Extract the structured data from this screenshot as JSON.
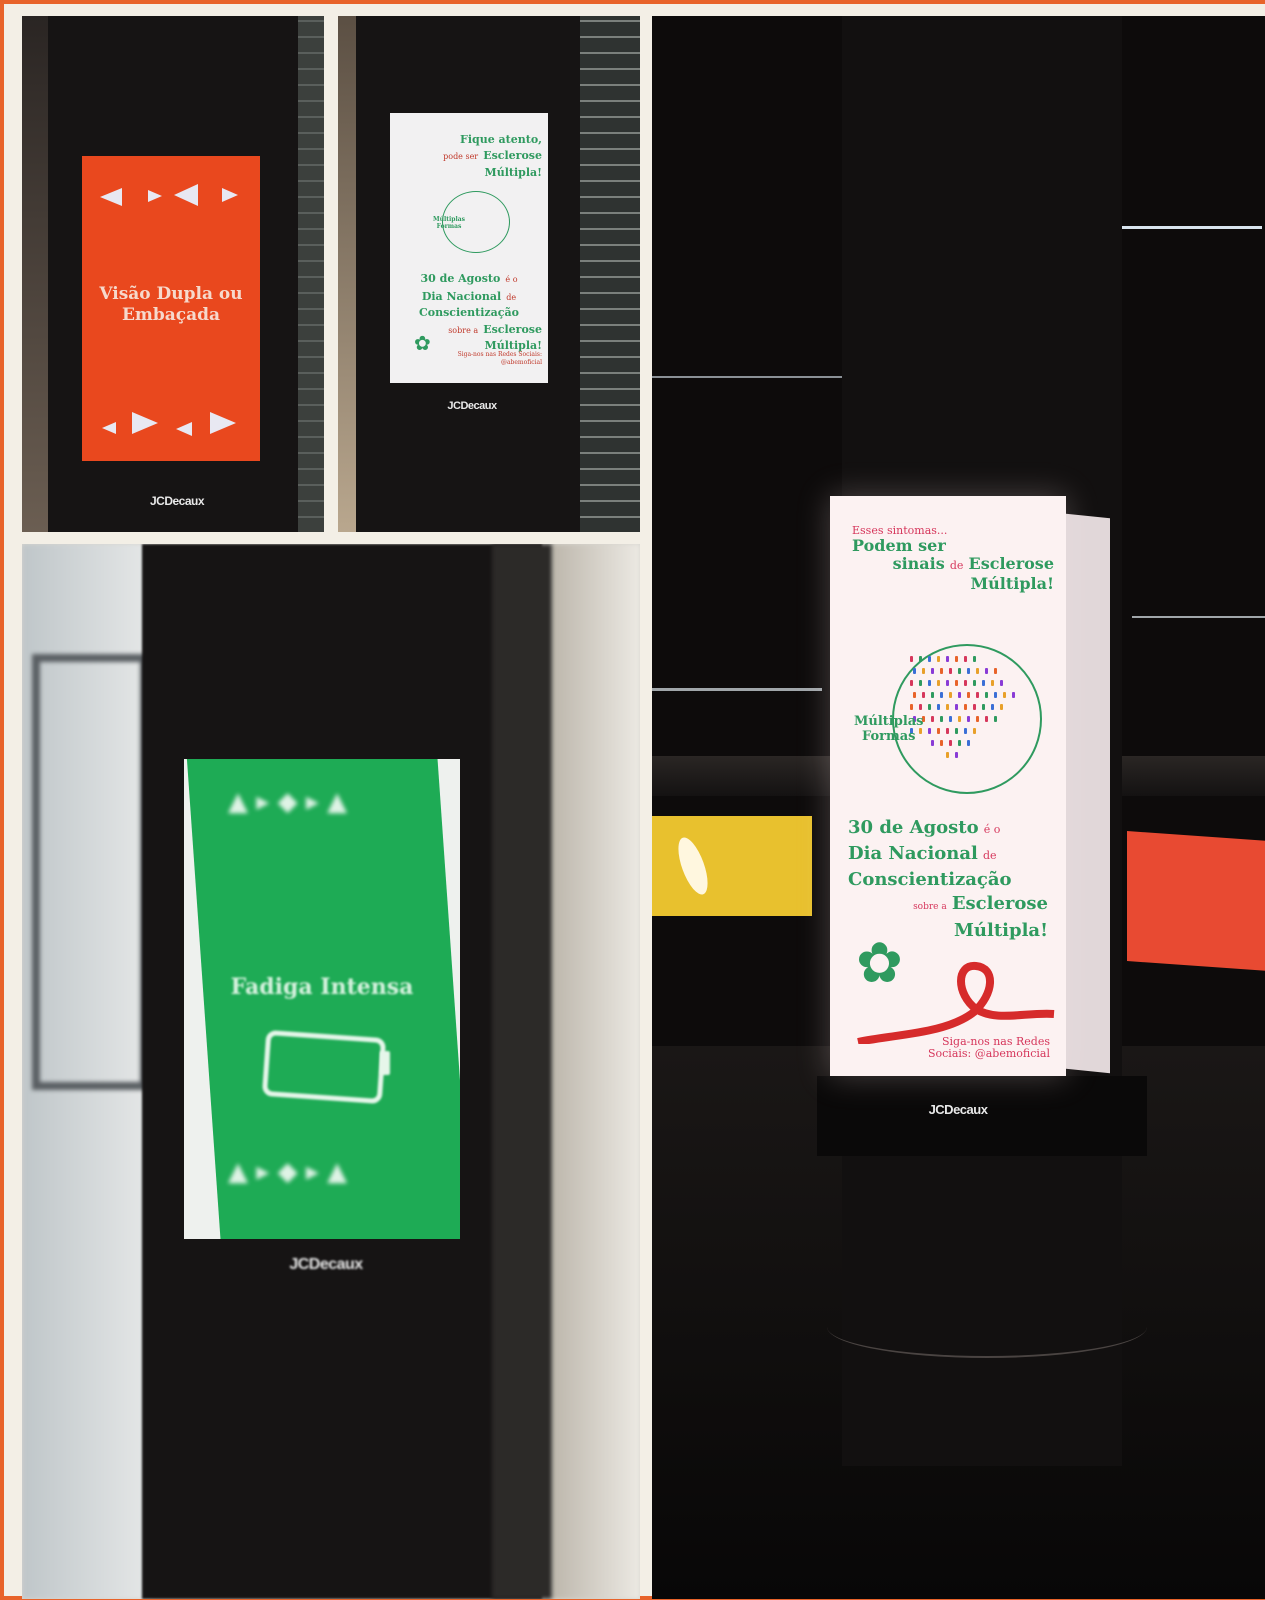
{
  "photos": {
    "top_left": {
      "screen_text": "Visão Dupla ou Embaçada",
      "brand": "JCDecaux",
      "colors": {
        "screen": "#e9481e",
        "text": "#f6d9cc"
      }
    },
    "top_right": {
      "headline_small": "Fique atento,",
      "headline_mid": "pode ser",
      "headline_big": "Esclerose Múltipla!",
      "logo_text": "Múltiplas Formas",
      "date_line1": "30 de Agosto",
      "date_line1_suffix": "é o",
      "date_line2": "Dia Nacional",
      "date_line2_suffix": "de",
      "date_line3": "Conscientização",
      "date_line4_prefix": "sobre a",
      "date_line4": "Esclerose",
      "date_line5": "Múltipla!",
      "footer": "Siga-nos nas Redes Sociais: @abemoficial",
      "brand": "JCDecaux"
    },
    "bottom_left": {
      "screen_text": "Fadiga Intensa",
      "brand": "JCDecaux",
      "colors": {
        "screen": "#1eab55"
      }
    },
    "right": {
      "line_small": "Esses sintomas...",
      "line_big1": "Podem ser",
      "line_big2_a": "sinais",
      "line_big2_b": "de",
      "line_big2_c": "Esclerose",
      "line_big3": "Múltipla!",
      "logo_text_1": "Múltiplas",
      "logo_text_2": "Formas",
      "date_line1": "30 de Agosto",
      "date_line1_suffix": "é o",
      "date_line2": "Dia Nacional",
      "date_line2_suffix": "de",
      "date_line3": "Conscientização",
      "date_line4_prefix": "sobre a",
      "date_line4": "Esclerose",
      "date_line5": "Múltipla!",
      "footer_1": "Siga-nos nas Redes",
      "footer_2": "Sociais: @abemoficial",
      "brand": "JCDecaux",
      "colors": {
        "green": "#2f9a5f",
        "pink": "#d6375c",
        "ribbon": "#d62b2b"
      }
    }
  },
  "icons": [
    "arrow-triangle-icon",
    "battery-empty-icon",
    "bird-icon",
    "flower-icon",
    "ribbon-icon",
    "brazil-map-people-icon"
  ]
}
